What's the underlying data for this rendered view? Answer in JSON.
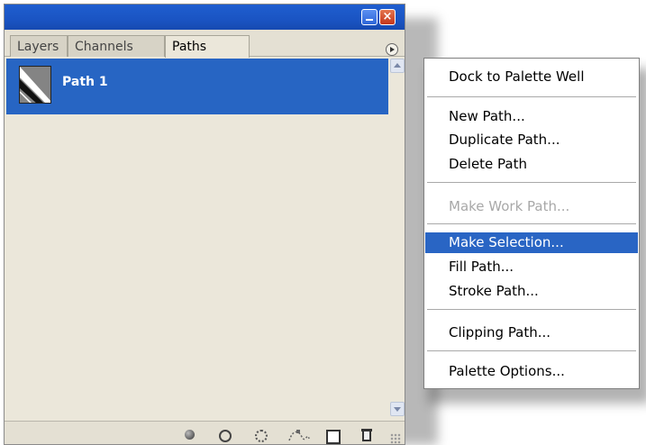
{
  "tabs": [
    {
      "label": "Layers",
      "active": false
    },
    {
      "label": "Channels",
      "active": false
    },
    {
      "label": "Paths",
      "active": true
    }
  ],
  "paths": [
    {
      "name": "Path 1",
      "selected": true
    }
  ],
  "menu": {
    "items": [
      {
        "label": "Dock to Palette Well",
        "state": "normal"
      },
      {
        "label": "New Path...",
        "state": "normal"
      },
      {
        "label": "Duplicate Path...",
        "state": "normal"
      },
      {
        "label": "Delete Path",
        "state": "normal"
      },
      {
        "label": "Make Work Path...",
        "state": "disabled"
      },
      {
        "label": "Make Selection...",
        "state": "highlighted"
      },
      {
        "label": "Fill Path...",
        "state": "normal"
      },
      {
        "label": "Stroke Path...",
        "state": "normal"
      },
      {
        "label": "Clipping Path...",
        "state": "normal"
      },
      {
        "label": "Palette Options...",
        "state": "normal"
      }
    ]
  },
  "bottom_icons": [
    "fill-path-icon",
    "stroke-path-icon",
    "load-selection-icon",
    "make-work-path-icon",
    "new-path-icon",
    "trash-icon"
  ],
  "colors": {
    "titlebar": "#1a54c3",
    "selection": "#2765c3",
    "menu_highlight": "#2965c4",
    "panel_bg": "#ebe7da"
  }
}
